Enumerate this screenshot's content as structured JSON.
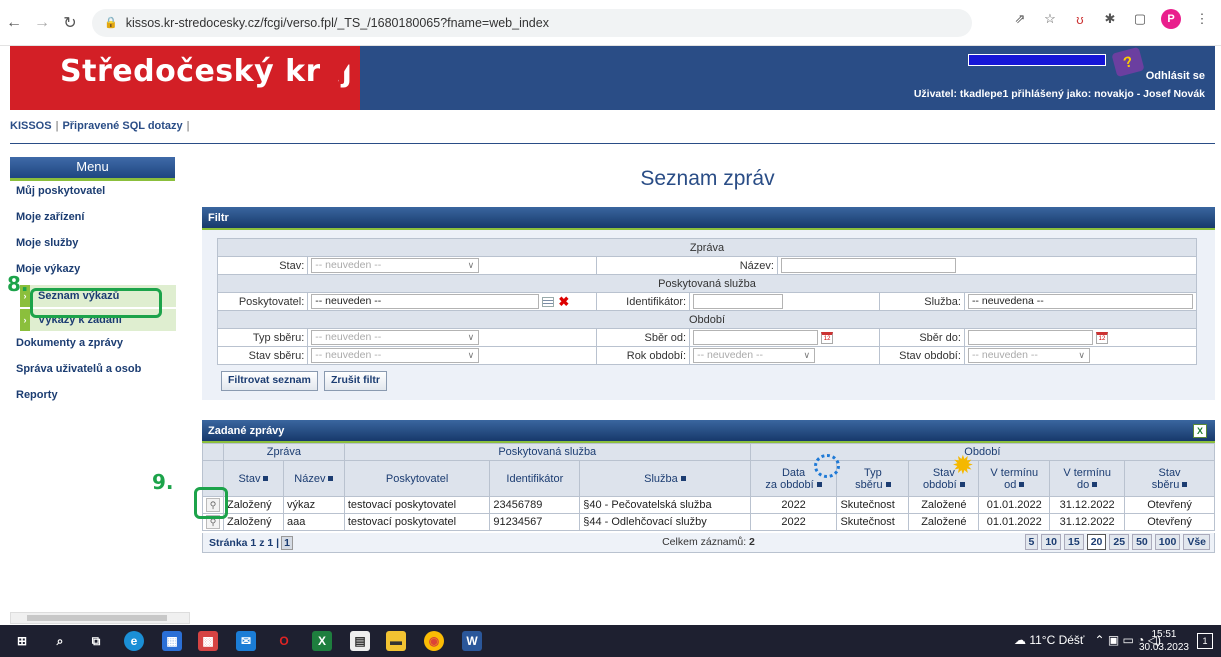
{
  "browser": {
    "url": "kissos.kr-stredocesky.cz/fcgi/verso.fpl/_TS_/1680180065?fname=web_index"
  },
  "header": {
    "brand": "Středočeský kraj",
    "logout": "Odhlásit se",
    "user_line": "Uživatel: tkadlepe1 přihlášený jako: novakjo - Josef Novák"
  },
  "breadcrumb": {
    "home": "KISSOS",
    "sql": "Připravené SQL dotazy"
  },
  "sidebar": {
    "menu_title": "Menu",
    "items": {
      "my_provider": "Můj poskytovatel",
      "my_facilities": "Moje zařízení",
      "my_services": "Moje služby",
      "my_reports": "Moje výkazy",
      "report_list": "Seznam výkazů",
      "reports_to_enter": "Výkazy k zadání",
      "documents": "Dokumenty a zprávy",
      "user_admin": "Správa uživatelů a osob",
      "reports": "Reporty"
    },
    "step_8": "8.",
    "step_9": "9."
  },
  "main": {
    "title": "Seznam zpráv",
    "filter": {
      "bar": "Filtr",
      "sec_message": "Zpráva",
      "stav_label": "Stav:",
      "stav_value": "-- neuveden --",
      "nazev_label": "Název:",
      "sec_service": "Poskytovaná služba",
      "provider_label": "Poskytovatel:",
      "provider_value": "-- neuveden --",
      "ident_label": "Identifikátor:",
      "service_label": "Služba:",
      "service_value": "-- neuvedena --",
      "sec_period": "Období",
      "typ_label": "Typ sběru:",
      "typ_value": "-- neuveden --",
      "sber_od_label": "Sběr od:",
      "sber_do_label": "Sběr do:",
      "stav_sberu_label": "Stav sběru:",
      "stav_sberu_value": "-- neuveden --",
      "rok_label": "Rok období:",
      "rok_value": "-- neuveden --",
      "stav_obdobi_label": "Stav období:",
      "stav_obdobi_value": "-- neuveden --",
      "btn_filter": "Filtrovat seznam",
      "btn_clear": "Zrušit filtr"
    },
    "results": {
      "bar": "Zadané zprávy",
      "group_message": "Zpráva",
      "group_service": "Poskytovaná služba",
      "group_period": "Období",
      "col_stav": "Stav",
      "col_nazev": "Název",
      "col_provider": "Poskytovatel",
      "col_ident": "Identifikátor",
      "col_service": "Služba",
      "col_data_1": "Data",
      "col_data_2": "za období",
      "col_typ_1": "Typ",
      "col_typ_2": "sběru",
      "col_stavob_1": "Stav",
      "col_stavob_2": "období",
      "col_od_1": "V termínu",
      "col_od_2": "od",
      "col_do_1": "V termínu",
      "col_do_2": "do",
      "col_stavsb_1": "Stav",
      "col_stavsb_2": "sběru",
      "rows": [
        [
          "Založený",
          "výkaz",
          "testovací poskytovatel",
          "23456789",
          "§40 - Pečovatelská služba",
          "2022",
          "Skutečnost",
          "Založené",
          "01.01.2022",
          "31.12.2022",
          "Otevřený"
        ],
        [
          "Založený",
          "aaa",
          "testovací poskytovatel",
          "91234567",
          "§44 - Odlehčovací služby",
          "2022",
          "Skutečnost",
          "Založené",
          "01.01.2022",
          "31.12.2022",
          "Otevřený"
        ]
      ],
      "page_prefix": "Stránka 1 z 1 |",
      "page_current": "1",
      "total_label": "Celkem záznamů:",
      "total_value": "2",
      "page_sizes": [
        "5",
        "10",
        "15",
        "20",
        "25",
        "50",
        "100",
        "Vše"
      ]
    }
  },
  "taskbar": {
    "weather": "11°C Déšť",
    "time": "15:51",
    "date": "30.03.2023",
    "notif": "1"
  },
  "colors": {
    "brand_red": "#d31f26",
    "header_blue": "#2a4d86",
    "accent_green": "#8bbf3c",
    "annotation_green": "#1ca34a"
  }
}
